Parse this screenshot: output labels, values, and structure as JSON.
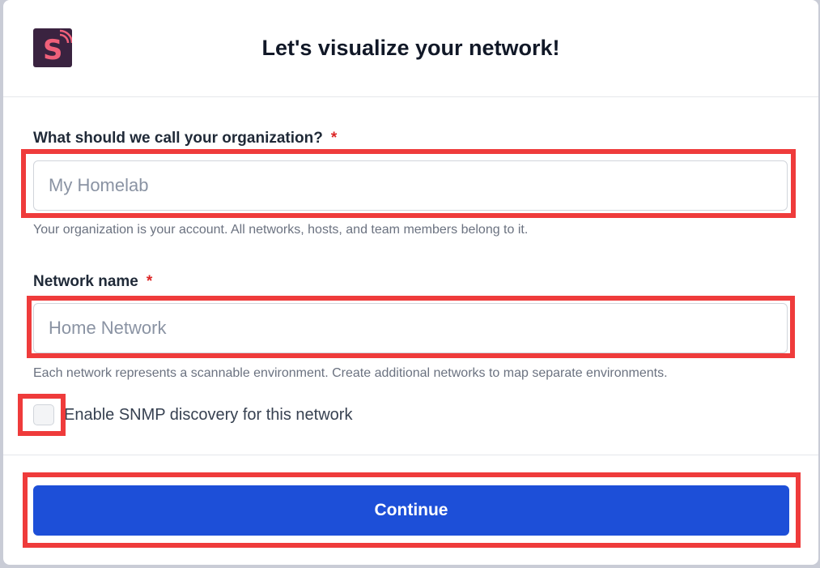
{
  "header": {
    "logo_letter": "S",
    "title": "Let's visualize your network!"
  },
  "organization": {
    "label": "What should we call your organization?",
    "required_mark": "*",
    "value": "",
    "placeholder": "My Homelab",
    "hint": "Your organization is your account. All networks, hosts, and team members belong to it."
  },
  "network": {
    "label": "Network name",
    "required_mark": "*",
    "value": "",
    "placeholder": "Home Network",
    "hint": "Each network represents a scannable environment. Create additional networks to map separate environments."
  },
  "snmp": {
    "label": "Enable SNMP discovery for this network",
    "checked": false
  },
  "footer": {
    "continue_label": "Continue"
  },
  "colors": {
    "accent": "#1d4fd8",
    "required": "#dc2626",
    "highlight": "#ef3b3b",
    "logo_bg": "#3a2340",
    "logo_fg": "#f0607a"
  }
}
